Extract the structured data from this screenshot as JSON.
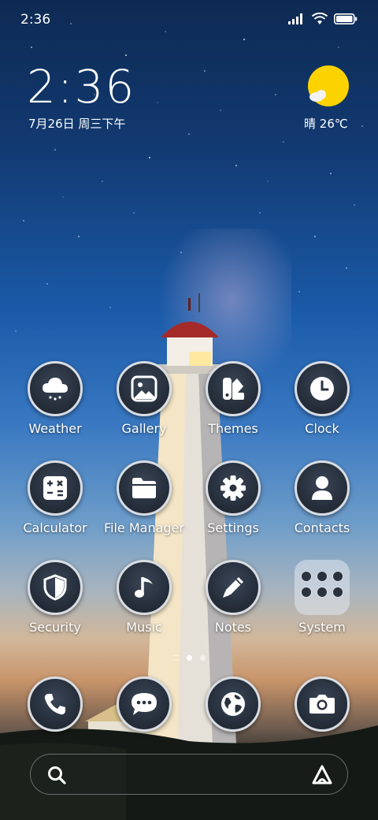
{
  "status_bar": {
    "time": "2:36"
  },
  "clock": {
    "time": "2:36",
    "date": "7月26日 周三下午"
  },
  "weather_widget": {
    "condition": "晴",
    "temperature": "26℃",
    "icon": "sun-cloud-icon"
  },
  "apps": [
    {
      "label": "Weather",
      "icon": "weather-cloud-icon"
    },
    {
      "label": "Gallery",
      "icon": "gallery-icon"
    },
    {
      "label": "Themes",
      "icon": "themes-icon"
    },
    {
      "label": "Clock",
      "icon": "clock-icon"
    },
    {
      "label": "Calculator",
      "icon": "calculator-icon"
    },
    {
      "label": "File Manager",
      "icon": "folder-icon"
    },
    {
      "label": "Settings",
      "icon": "gear-icon"
    },
    {
      "label": "Contacts",
      "icon": "person-icon"
    },
    {
      "label": "Security",
      "icon": "shield-icon"
    },
    {
      "label": "Music",
      "icon": "music-note-icon"
    },
    {
      "label": "Notes",
      "icon": "pencil-icon"
    },
    {
      "label": "System",
      "icon": "folder-grid-icon"
    }
  ],
  "dock": [
    {
      "icon": "phone-icon"
    },
    {
      "icon": "message-icon"
    },
    {
      "icon": "globe-icon"
    },
    {
      "icon": "camera-icon"
    }
  ],
  "page_indicator": {
    "current": 1,
    "total": 2
  },
  "colors": {
    "icon_bg": "#2a323e",
    "icon_border": "#d9dde3",
    "sun": "#fcd300"
  }
}
